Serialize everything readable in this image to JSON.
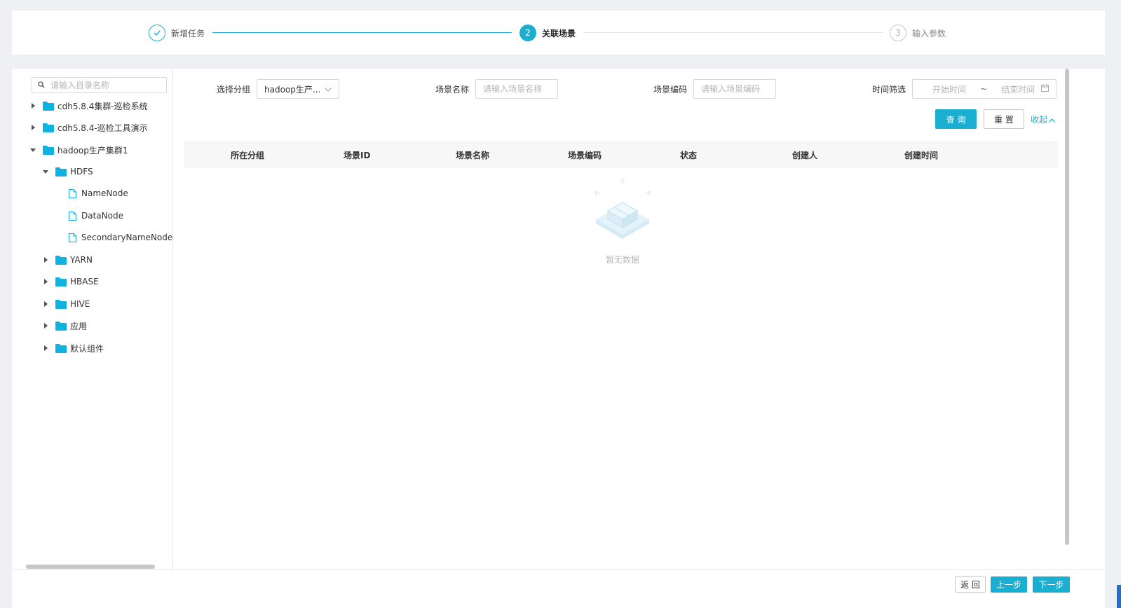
{
  "steps": [
    {
      "title": "新增任务",
      "number": "",
      "status": "done"
    },
    {
      "title": "关联场景",
      "number": "2",
      "status": "active"
    },
    {
      "title": "输入参数",
      "number": "3",
      "status": "wait"
    }
  ],
  "sidebar": {
    "search_placeholder": "请输入目录名称",
    "tree": [
      {
        "label": "cdh5.8.4集群-巡检系统",
        "type": "folder",
        "level": 0,
        "expanded": false
      },
      {
        "label": "cdh5.8.4-巡检工具演示",
        "type": "folder",
        "level": 0,
        "expanded": false
      },
      {
        "label": "hadoop生产集群1",
        "type": "folder",
        "level": 0,
        "expanded": true
      },
      {
        "label": "HDFS",
        "type": "folder",
        "level": 1,
        "expanded": true
      },
      {
        "label": "NameNode",
        "type": "file",
        "level": 2
      },
      {
        "label": "DataNode",
        "type": "file",
        "level": 2
      },
      {
        "label": "SecondaryNameNode",
        "type": "file",
        "level": 2
      },
      {
        "label": "YARN",
        "type": "folder",
        "level": 1,
        "expanded": false
      },
      {
        "label": "HBASE",
        "type": "folder",
        "level": 1,
        "expanded": false
      },
      {
        "label": "HIVE",
        "type": "folder",
        "level": 1,
        "expanded": false
      },
      {
        "label": "应用",
        "type": "folder",
        "level": 1,
        "expanded": false
      },
      {
        "label": "默认组件",
        "type": "folder",
        "level": 1,
        "expanded": false
      }
    ]
  },
  "filters": {
    "group_label": "选择分组",
    "group_value": "hadoop生产...",
    "name_label": "场景名称",
    "name_placeholder": "请输入场景名称",
    "code_label": "场景编码",
    "code_placeholder": "请输入场景编码",
    "time_label": "时间筛选",
    "start_placeholder": "开始时间",
    "range_separator": "~",
    "end_placeholder": "结束时间"
  },
  "actions": {
    "query_label": "查 询",
    "reset_label": "重 置",
    "collapse_label": "收起"
  },
  "table": {
    "columns": [
      "所在分组",
      "场景ID",
      "场景名称",
      "场景编码",
      "状态",
      "创建人",
      "创建时间"
    ],
    "rows": [],
    "empty_text": "暂无数据"
  },
  "footer": {
    "back_label": "返 回",
    "prev_label": "上一步",
    "next_label": "下一步"
  },
  "colors": {
    "accent": "#1aafd0",
    "folder": "#0fb2e0",
    "inactive_line": "#e3e3e3"
  },
  "icons": {
    "done_step": "check-icon",
    "tree_search": "search-icon",
    "group_select": "chevron-down-icon",
    "calendar": "calendar-icon",
    "collapse": "chevron-up-icon",
    "empty": "empty-box-icon"
  }
}
